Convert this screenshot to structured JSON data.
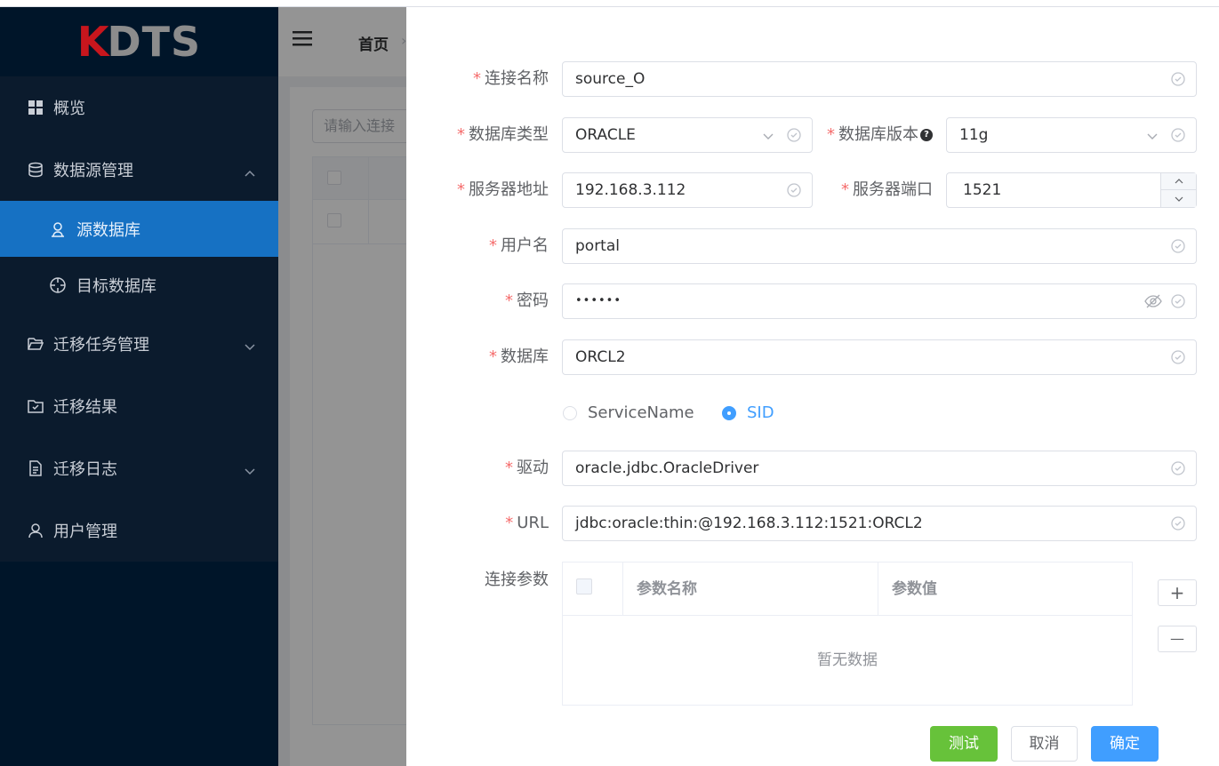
{
  "app": {
    "logo_k": "K",
    "logo_rest": "DTS"
  },
  "sidebar": {
    "items": [
      {
        "label": "概览"
      },
      {
        "label": "数据源管理"
      },
      {
        "label": "源数据库"
      },
      {
        "label": "目标数据库"
      },
      {
        "label": "迁移任务管理"
      },
      {
        "label": "迁移结果"
      },
      {
        "label": "迁移日志"
      },
      {
        "label": "用户管理"
      }
    ]
  },
  "header": {
    "breadcrumb": "首页",
    "breadcrumb_sep": "›"
  },
  "list": {
    "search_placeholder": "请输入连接"
  },
  "form": {
    "required_mark": "*",
    "conn_name": {
      "label": "连接名称",
      "value": "source_O"
    },
    "db_type": {
      "label": "数据库类型",
      "value": "ORACLE"
    },
    "db_version": {
      "label": "数据库版本",
      "value": "11g",
      "help": "?"
    },
    "server_addr": {
      "label": "服务器地址",
      "value": "192.168.3.112"
    },
    "server_port": {
      "label": "服务器端口",
      "value": "1521"
    },
    "username": {
      "label": "用户名",
      "value": "portal"
    },
    "password": {
      "label": "密码",
      "value": "••••••"
    },
    "database": {
      "label": "数据库",
      "value": "ORCL2"
    },
    "conn_mode": {
      "option_service": "ServiceName",
      "option_sid": "SID",
      "selected": "SID"
    },
    "driver": {
      "label": "驱动",
      "value": "oracle.jdbc.OracleDriver"
    },
    "url": {
      "label": "URL",
      "value": "jdbc:oracle:thin:@192.168.3.112:1521:ORCL2"
    },
    "params": {
      "label": "连接参数",
      "col_name": "参数名称",
      "col_value": "参数值",
      "empty_text": "暂无数据",
      "add_label": "+",
      "remove_label": "—"
    }
  },
  "actions": {
    "test": "测试",
    "cancel": "取消",
    "confirm": "确定"
  },
  "colors": {
    "sidebar_bg": "#001529",
    "active_item": "#1671c3",
    "primary": "#409eff",
    "success": "#67c23a",
    "required": "#f56c6c"
  }
}
